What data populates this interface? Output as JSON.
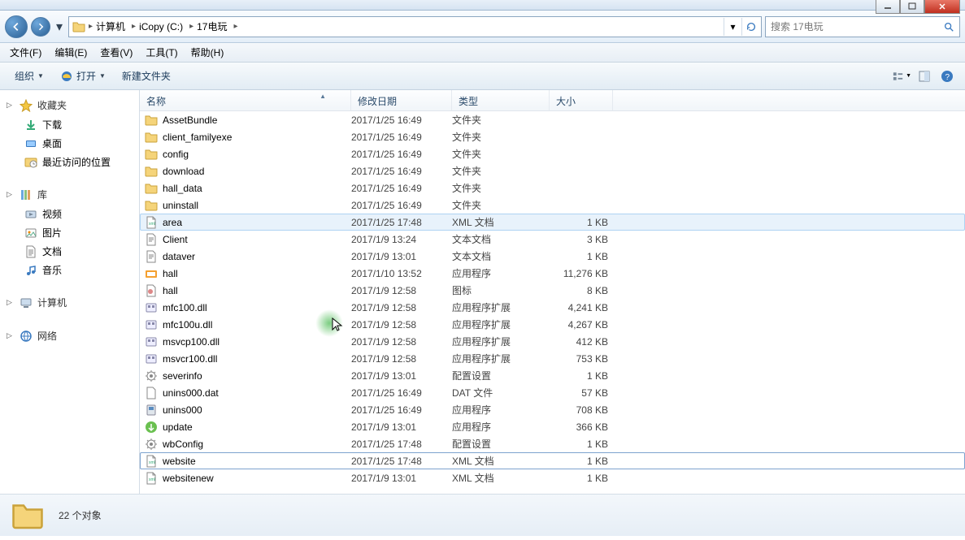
{
  "window": {
    "min": "",
    "max": "",
    "close": ""
  },
  "breadcrumbs": [
    "计算机",
    "iCopy (C:)",
    "17电玩"
  ],
  "search_placeholder": "搜索 17电玩",
  "menu": {
    "file": "文件(F)",
    "edit": "编辑(E)",
    "view": "查看(V)",
    "tools": "工具(T)",
    "help": "帮助(H)"
  },
  "toolbar": {
    "organize": "组织",
    "open": "打开",
    "newfolder": "新建文件夹"
  },
  "sidebar": {
    "favorites": {
      "label": "收藏夹",
      "items": [
        "下载",
        "桌面",
        "最近访问的位置"
      ]
    },
    "libraries": {
      "label": "库",
      "items": [
        "视频",
        "图片",
        "文档",
        "音乐"
      ]
    },
    "computer": {
      "label": "计算机"
    },
    "network": {
      "label": "网络"
    }
  },
  "columns": {
    "name": "名称",
    "date": "修改日期",
    "type": "类型",
    "size": "大小"
  },
  "rows": [
    {
      "ic": "folder",
      "n": "AssetBundle",
      "d": "2017/1/25 16:49",
      "t": "文件夹",
      "s": ""
    },
    {
      "ic": "folder",
      "n": "client_familyexe",
      "d": "2017/1/25 16:49",
      "t": "文件夹",
      "s": ""
    },
    {
      "ic": "folder",
      "n": "config",
      "d": "2017/1/25 16:49",
      "t": "文件夹",
      "s": ""
    },
    {
      "ic": "folder",
      "n": "download",
      "d": "2017/1/25 16:49",
      "t": "文件夹",
      "s": ""
    },
    {
      "ic": "folder",
      "n": "hall_data",
      "d": "2017/1/25 16:49",
      "t": "文件夹",
      "s": ""
    },
    {
      "ic": "folder",
      "n": "uninstall",
      "d": "2017/1/25 16:49",
      "t": "文件夹",
      "s": ""
    },
    {
      "ic": "xml",
      "n": "area",
      "d": "2017/1/25 17:48",
      "t": "XML 文档",
      "s": "1 KB",
      "hov": true
    },
    {
      "ic": "txt",
      "n": "Client",
      "d": "2017/1/9 13:24",
      "t": "文本文档",
      "s": "3 KB"
    },
    {
      "ic": "txt",
      "n": "dataver",
      "d": "2017/1/9 13:01",
      "t": "文本文档",
      "s": "1 KB"
    },
    {
      "ic": "exe",
      "n": "hall",
      "d": "2017/1/10 13:52",
      "t": "应用程序",
      "s": "11,276 KB"
    },
    {
      "ic": "ico",
      "n": "hall",
      "d": "2017/1/9 12:58",
      "t": "图标",
      "s": "8 KB"
    },
    {
      "ic": "dll",
      "n": "mfc100.dll",
      "d": "2017/1/9 12:58",
      "t": "应用程序扩展",
      "s": "4,241 KB"
    },
    {
      "ic": "dll",
      "n": "mfc100u.dll",
      "d": "2017/1/9 12:58",
      "t": "应用程序扩展",
      "s": "4,267 KB"
    },
    {
      "ic": "dll",
      "n": "msvcp100.dll",
      "d": "2017/1/9 12:58",
      "t": "应用程序扩展",
      "s": "412 KB"
    },
    {
      "ic": "dll",
      "n": "msvcr100.dll",
      "d": "2017/1/9 12:58",
      "t": "应用程序扩展",
      "s": "753 KB"
    },
    {
      "ic": "cfg",
      "n": "severinfo",
      "d": "2017/1/9 13:01",
      "t": "配置设置",
      "s": "1 KB"
    },
    {
      "ic": "dat",
      "n": "unins000.dat",
      "d": "2017/1/25 16:49",
      "t": "DAT 文件",
      "s": "57 KB"
    },
    {
      "ic": "unins",
      "n": "unins000",
      "d": "2017/1/25 16:49",
      "t": "应用程序",
      "s": "708 KB"
    },
    {
      "ic": "upd",
      "n": "update",
      "d": "2017/1/9 13:01",
      "t": "应用程序",
      "s": "366 KB"
    },
    {
      "ic": "cfg",
      "n": "wbConfig",
      "d": "2017/1/25 17:48",
      "t": "配置设置",
      "s": "1 KB"
    },
    {
      "ic": "xml",
      "n": "website",
      "d": "2017/1/25 17:48",
      "t": "XML 文档",
      "s": "1 KB",
      "sel": true
    },
    {
      "ic": "xml",
      "n": "websitenew",
      "d": "2017/1/9 13:01",
      "t": "XML 文档",
      "s": "1 KB"
    }
  ],
  "status": {
    "count": "22 个对象"
  }
}
